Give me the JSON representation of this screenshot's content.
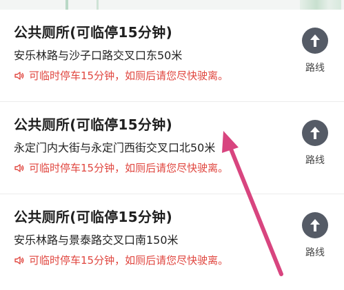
{
  "results": [
    {
      "title": "公共厕所(可临停15分钟)",
      "address": "安乐林路与沙子口路交叉口东50米",
      "notice": "可临时停车15分钟，如厕后请您尽快驶离。",
      "route_label": "路线"
    },
    {
      "title": "公共厕所(可临停15分钟)",
      "address": "永定门内大街与永定门西街交叉口北50米",
      "notice": "可临时停车15分钟，如厕后请您尽快驶离。",
      "route_label": "路线"
    },
    {
      "title": "公共厕所(可临停15分钟)",
      "address": "安乐林路与景泰路交叉口南150米",
      "notice": "可临时停车15分钟，如厕后请您尽快驶离。",
      "route_label": "路线"
    }
  ],
  "icons": {
    "route": "navigation-arrow-icon",
    "notice": "speaker-icon",
    "annotation": "pink-pointer-arrow"
  },
  "colors": {
    "title": "#1f1f1f",
    "notice": "#e0463f",
    "route_button": "#555b66",
    "annotation_arrow": "#d8457f"
  }
}
